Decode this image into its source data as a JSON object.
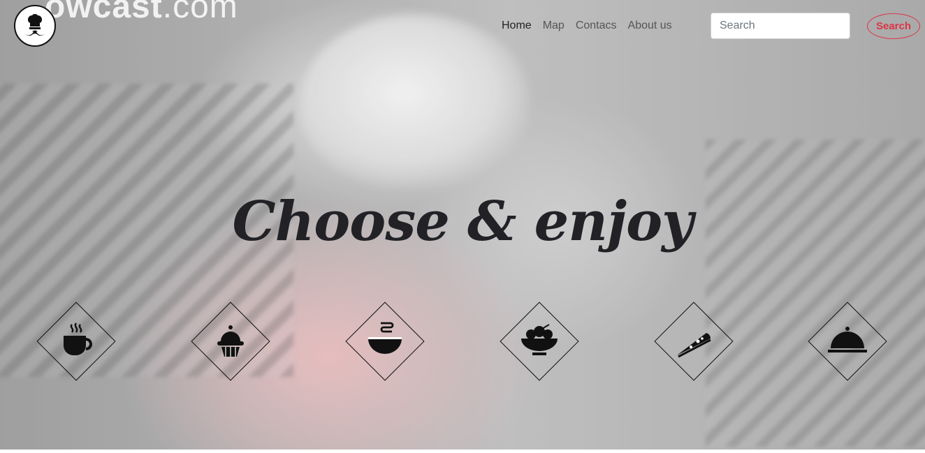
{
  "brand": {
    "watermark_bold": "owcast",
    "watermark_light": ".com",
    "logo_icon": "chef-mustache-icon"
  },
  "nav": {
    "items": [
      {
        "label": "Home",
        "active": true
      },
      {
        "label": "Map",
        "active": false
      },
      {
        "label": "Contacs",
        "active": false
      },
      {
        "label": "About us",
        "active": false
      }
    ]
  },
  "search": {
    "placeholder": "Search",
    "value": "",
    "button_label": "Search",
    "accent": "#dc3545"
  },
  "hero": {
    "headline": "Choose & enjoy"
  },
  "categories": [
    {
      "icon": "coffee-cup-icon"
    },
    {
      "icon": "cupcake-icon"
    },
    {
      "icon": "soup-bowl-icon"
    },
    {
      "icon": "salad-bowl-icon"
    },
    {
      "icon": "pizza-slice-icon"
    },
    {
      "icon": "cloche-icon"
    }
  ]
}
